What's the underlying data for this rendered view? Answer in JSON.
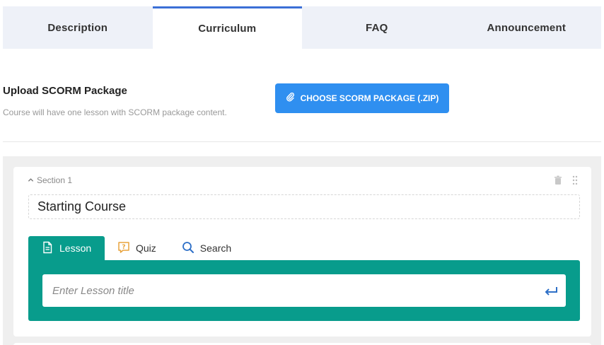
{
  "tabs": [
    {
      "label": "Description"
    },
    {
      "label": "Curriculum",
      "active": true
    },
    {
      "label": "FAQ"
    },
    {
      "label": "Announcement"
    }
  ],
  "upload": {
    "title": "Upload SCORM Package",
    "description": "Course will have one lesson with SCORM package content.",
    "button_label": "CHOOSE SCORM PACKAGE (.ZIP)",
    "button_icon": "paperclip-icon"
  },
  "section": {
    "label": "Section 1",
    "title": "Starting Course"
  },
  "item_tabs": [
    {
      "label": "Lesson",
      "icon": "document-icon"
    },
    {
      "label": "Quiz",
      "icon": "quiz-icon"
    },
    {
      "label": "Search",
      "icon": "search-icon"
    }
  ],
  "lesson_input": {
    "placeholder": "Enter Lesson title"
  },
  "colors": {
    "accent": "#089c8c",
    "button": "#2f8ff0",
    "tab_active_border": "#3b6fd6",
    "quiz_icon": "#e8a33d",
    "search_icon": "#2d6fc7"
  }
}
